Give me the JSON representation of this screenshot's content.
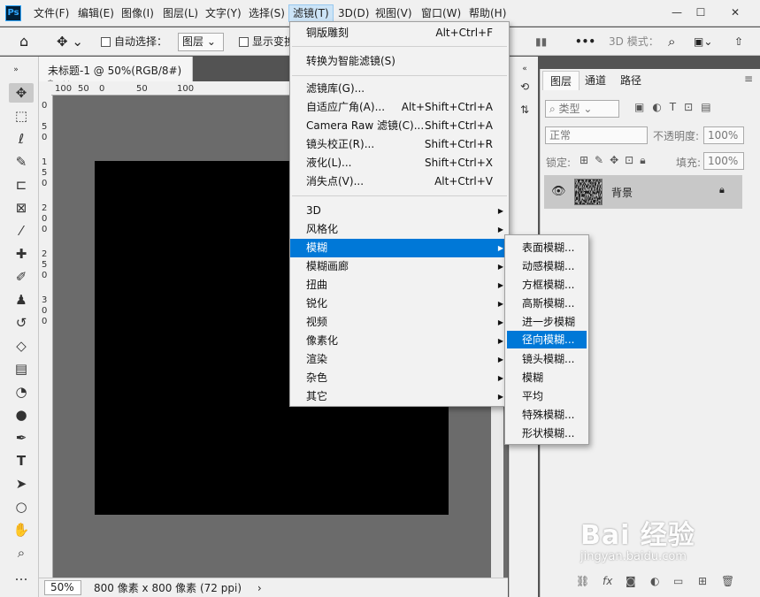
{
  "menubar": {
    "app_icon": "Ps",
    "items": [
      "文件(F)",
      "编辑(E)",
      "图像(I)",
      "图层(L)",
      "文字(Y)",
      "选择(S)",
      "滤镜(T)",
      "3D(D)",
      "视图(V)",
      "窗口(W)",
      "帮助(H)"
    ],
    "active_index": 6
  },
  "options": {
    "auto_select_label": "自动选择：",
    "layer_select": "图层",
    "show_transform_label": "显示变换控件",
    "mode_3d_label": "3D 模式："
  },
  "document": {
    "tab_title": "未标题-1 @ 50%(RGB/8#) *",
    "close": "×",
    "ruler_h": [
      "100",
      "50",
      "0",
      "50",
      "100"
    ],
    "ruler_v": [
      "0",
      "5",
      "0",
      "1",
      "5",
      "0",
      "2",
      "0",
      "0",
      "2",
      "5",
      "0",
      "3",
      "0",
      "0"
    ],
    "zoom": "50%",
    "info": "800 像素 x 800 像素 (72 ppi)",
    "info_arrow": "›"
  },
  "filter_menu": {
    "items": [
      {
        "label": "铜版雕刻",
        "shortcut": "Alt+Ctrl+F"
      },
      {
        "label": "转换为智能滤镜(S)",
        "shortcut": ""
      },
      {
        "label": "滤镜库(G)...",
        "shortcut": ""
      },
      {
        "label": "自适应广角(A)...",
        "shortcut": "Alt+Shift+Ctrl+A"
      },
      {
        "label": "Camera Raw 滤镜(C)...",
        "shortcut": "Shift+Ctrl+A"
      },
      {
        "label": "镜头校正(R)...",
        "shortcut": "Shift+Ctrl+R"
      },
      {
        "label": "液化(L)...",
        "shortcut": "Shift+Ctrl+X"
      },
      {
        "label": "消失点(V)...",
        "shortcut": "Alt+Ctrl+V"
      },
      {
        "label": "3D",
        "shortcut": ""
      },
      {
        "label": "风格化",
        "shortcut": ""
      },
      {
        "label": "模糊",
        "shortcut": ""
      },
      {
        "label": "模糊画廊",
        "shortcut": ""
      },
      {
        "label": "扭曲",
        "shortcut": ""
      },
      {
        "label": "锐化",
        "shortcut": ""
      },
      {
        "label": "视频",
        "shortcut": ""
      },
      {
        "label": "像素化",
        "shortcut": ""
      },
      {
        "label": "渲染",
        "shortcut": ""
      },
      {
        "label": "杂色",
        "shortcut": ""
      },
      {
        "label": "其它",
        "shortcut": ""
      }
    ],
    "highlighted": "模糊"
  },
  "blur_submenu": {
    "items": [
      "表面模糊...",
      "动感模糊...",
      "方框模糊...",
      "高斯模糊...",
      "进一步模糊",
      "径向模糊...",
      "镜头模糊...",
      "模糊",
      "平均",
      "特殊模糊...",
      "形状模糊..."
    ],
    "highlighted": "径向模糊..."
  },
  "layers_panel": {
    "tabs": [
      "图层",
      "通道",
      "路径"
    ],
    "kind_filter": "类型",
    "blend_mode": "正常",
    "opacity_label": "不透明度:",
    "opacity_value": "100%",
    "lock_label": "锁定:",
    "fill_label": "填充:",
    "fill_value": "100%",
    "layer_name": "背景"
  },
  "watermark": {
    "logo": "Bai 经验",
    "url": "jingyan.baidu.com"
  },
  "colors": {
    "highlight": "#0078d7",
    "canvas_bg": "#6b6b6b"
  }
}
